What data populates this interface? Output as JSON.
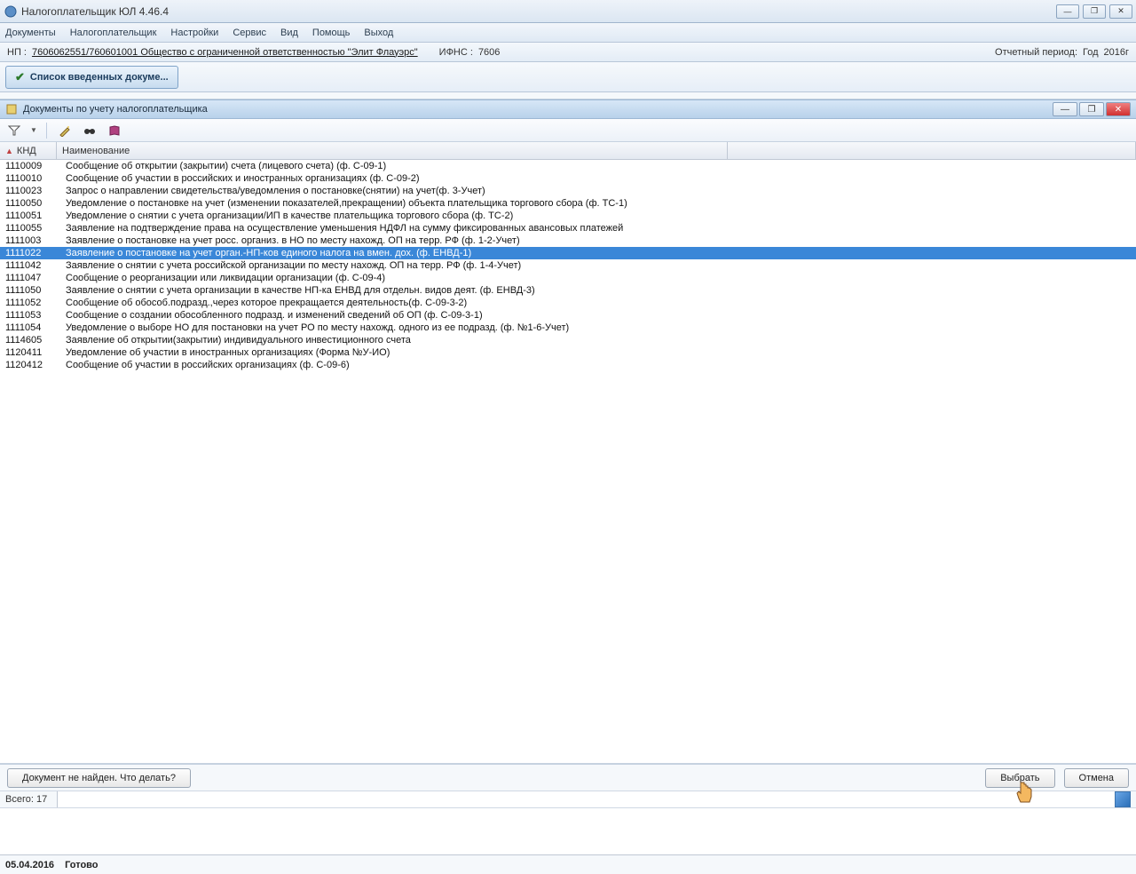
{
  "app": {
    "title": "Налогоплательщик ЮЛ 4.46.4"
  },
  "menu": {
    "items": [
      "Документы",
      "Налогоплательщик",
      "Настройки",
      "Сервис",
      "Вид",
      "Помощь",
      "Выход"
    ]
  },
  "info": {
    "np_label": "НП :",
    "np_value": "7606062551/760601001 Общество с ограниченной ответственностью \"Элит Флауэрс\"",
    "ifns_label": "ИФНС :",
    "ifns_value": "7606",
    "period_label": "Отчетный период:",
    "period_type": "Год",
    "period_value": "2016г"
  },
  "toolbar": {
    "list_btn": "Список введенных докуме..."
  },
  "inner": {
    "title": "Документы по учету налогоплательщика"
  },
  "grid": {
    "col_knd": "КНД",
    "col_name": "Наименование",
    "rows": [
      {
        "knd": "1110009",
        "name": "Сообщение об открытии (закрытии) счета (лицевого счета) (ф. С-09-1)"
      },
      {
        "knd": "1110010",
        "name": "Сообщение  об участии в российских и иностранных организациях (ф. С-09-2)"
      },
      {
        "knd": "1110023",
        "name": "Запрос о направлении свидетельства/уведомления о постановке(снятии) на учет(ф. 3-Учет)"
      },
      {
        "knd": "1110050",
        "name": "Уведомление о постановке на учет (изменении показателей,прекращении) объекта плательщика торгового сбора (ф. ТС-1)"
      },
      {
        "knd": "1110051",
        "name": "Уведомление о снятии с учета организации/ИП в качестве плательщика торгового сбора (ф. ТС-2)"
      },
      {
        "knd": "1110055",
        "name": "Заявление на подтверждение права на осуществление уменьшения НДФЛ на сумму фиксированных авансовых платежей"
      },
      {
        "knd": "1111003",
        "name": "Заявление о постановке на учет росс. организ. в НО по месту нахожд. ОП на терр. РФ (ф. 1-2-Учет)"
      },
      {
        "knd": "1111022",
        "name": "Заявление о постановке на учет орган.-НП-ков единого налога  на вмен. дох.  (ф. ЕНВД-1)",
        "selected": true
      },
      {
        "knd": "1111042",
        "name": "Заявление о снятии с учета  российской организации по месту нахожд. ОП на терр. РФ (ф. 1-4-Учет)"
      },
      {
        "knd": "1111047",
        "name": "Сообщение о реорганизации или ликвидации организации (ф. С-09-4)"
      },
      {
        "knd": "1111050",
        "name": "Заявление о снятии с учета организации в качестве НП-ка ЕНВД для отдельн. видов деят. (ф. ЕНВД-3)"
      },
      {
        "knd": "1111052",
        "name": "Сообщение об обособ.подразд.,через которое прекращается деятельность(ф. С-09-3-2)"
      },
      {
        "knd": "1111053",
        "name": "Сообщение о создании обособленного подразд. и изменений сведений об ОП (ф. С-09-3-1)"
      },
      {
        "knd": "1111054",
        "name": "Уведомление о выборе НО для постановки на учет РО по месту нахожд. одного из ее подразд. (ф. №1-6-Учет)"
      },
      {
        "knd": "1114605",
        "name": "Заявление об открытии(закрытии) индивидуального инвестиционного счета"
      },
      {
        "knd": "1120411",
        "name": "Уведомление об участии в иностранных организациях (Форма №У-ИО)"
      },
      {
        "knd": "1120412",
        "name": "Сообщение  об участии в российских организациях (ф. С-09-6)"
      }
    ]
  },
  "buttons": {
    "not_found": "Документ не найден. Что делать?",
    "select": "Выбрать",
    "cancel": "Отмена"
  },
  "status": {
    "total_label": "Всего: 17"
  },
  "footer": {
    "date": "05.04.2016",
    "ready": "Готово"
  }
}
